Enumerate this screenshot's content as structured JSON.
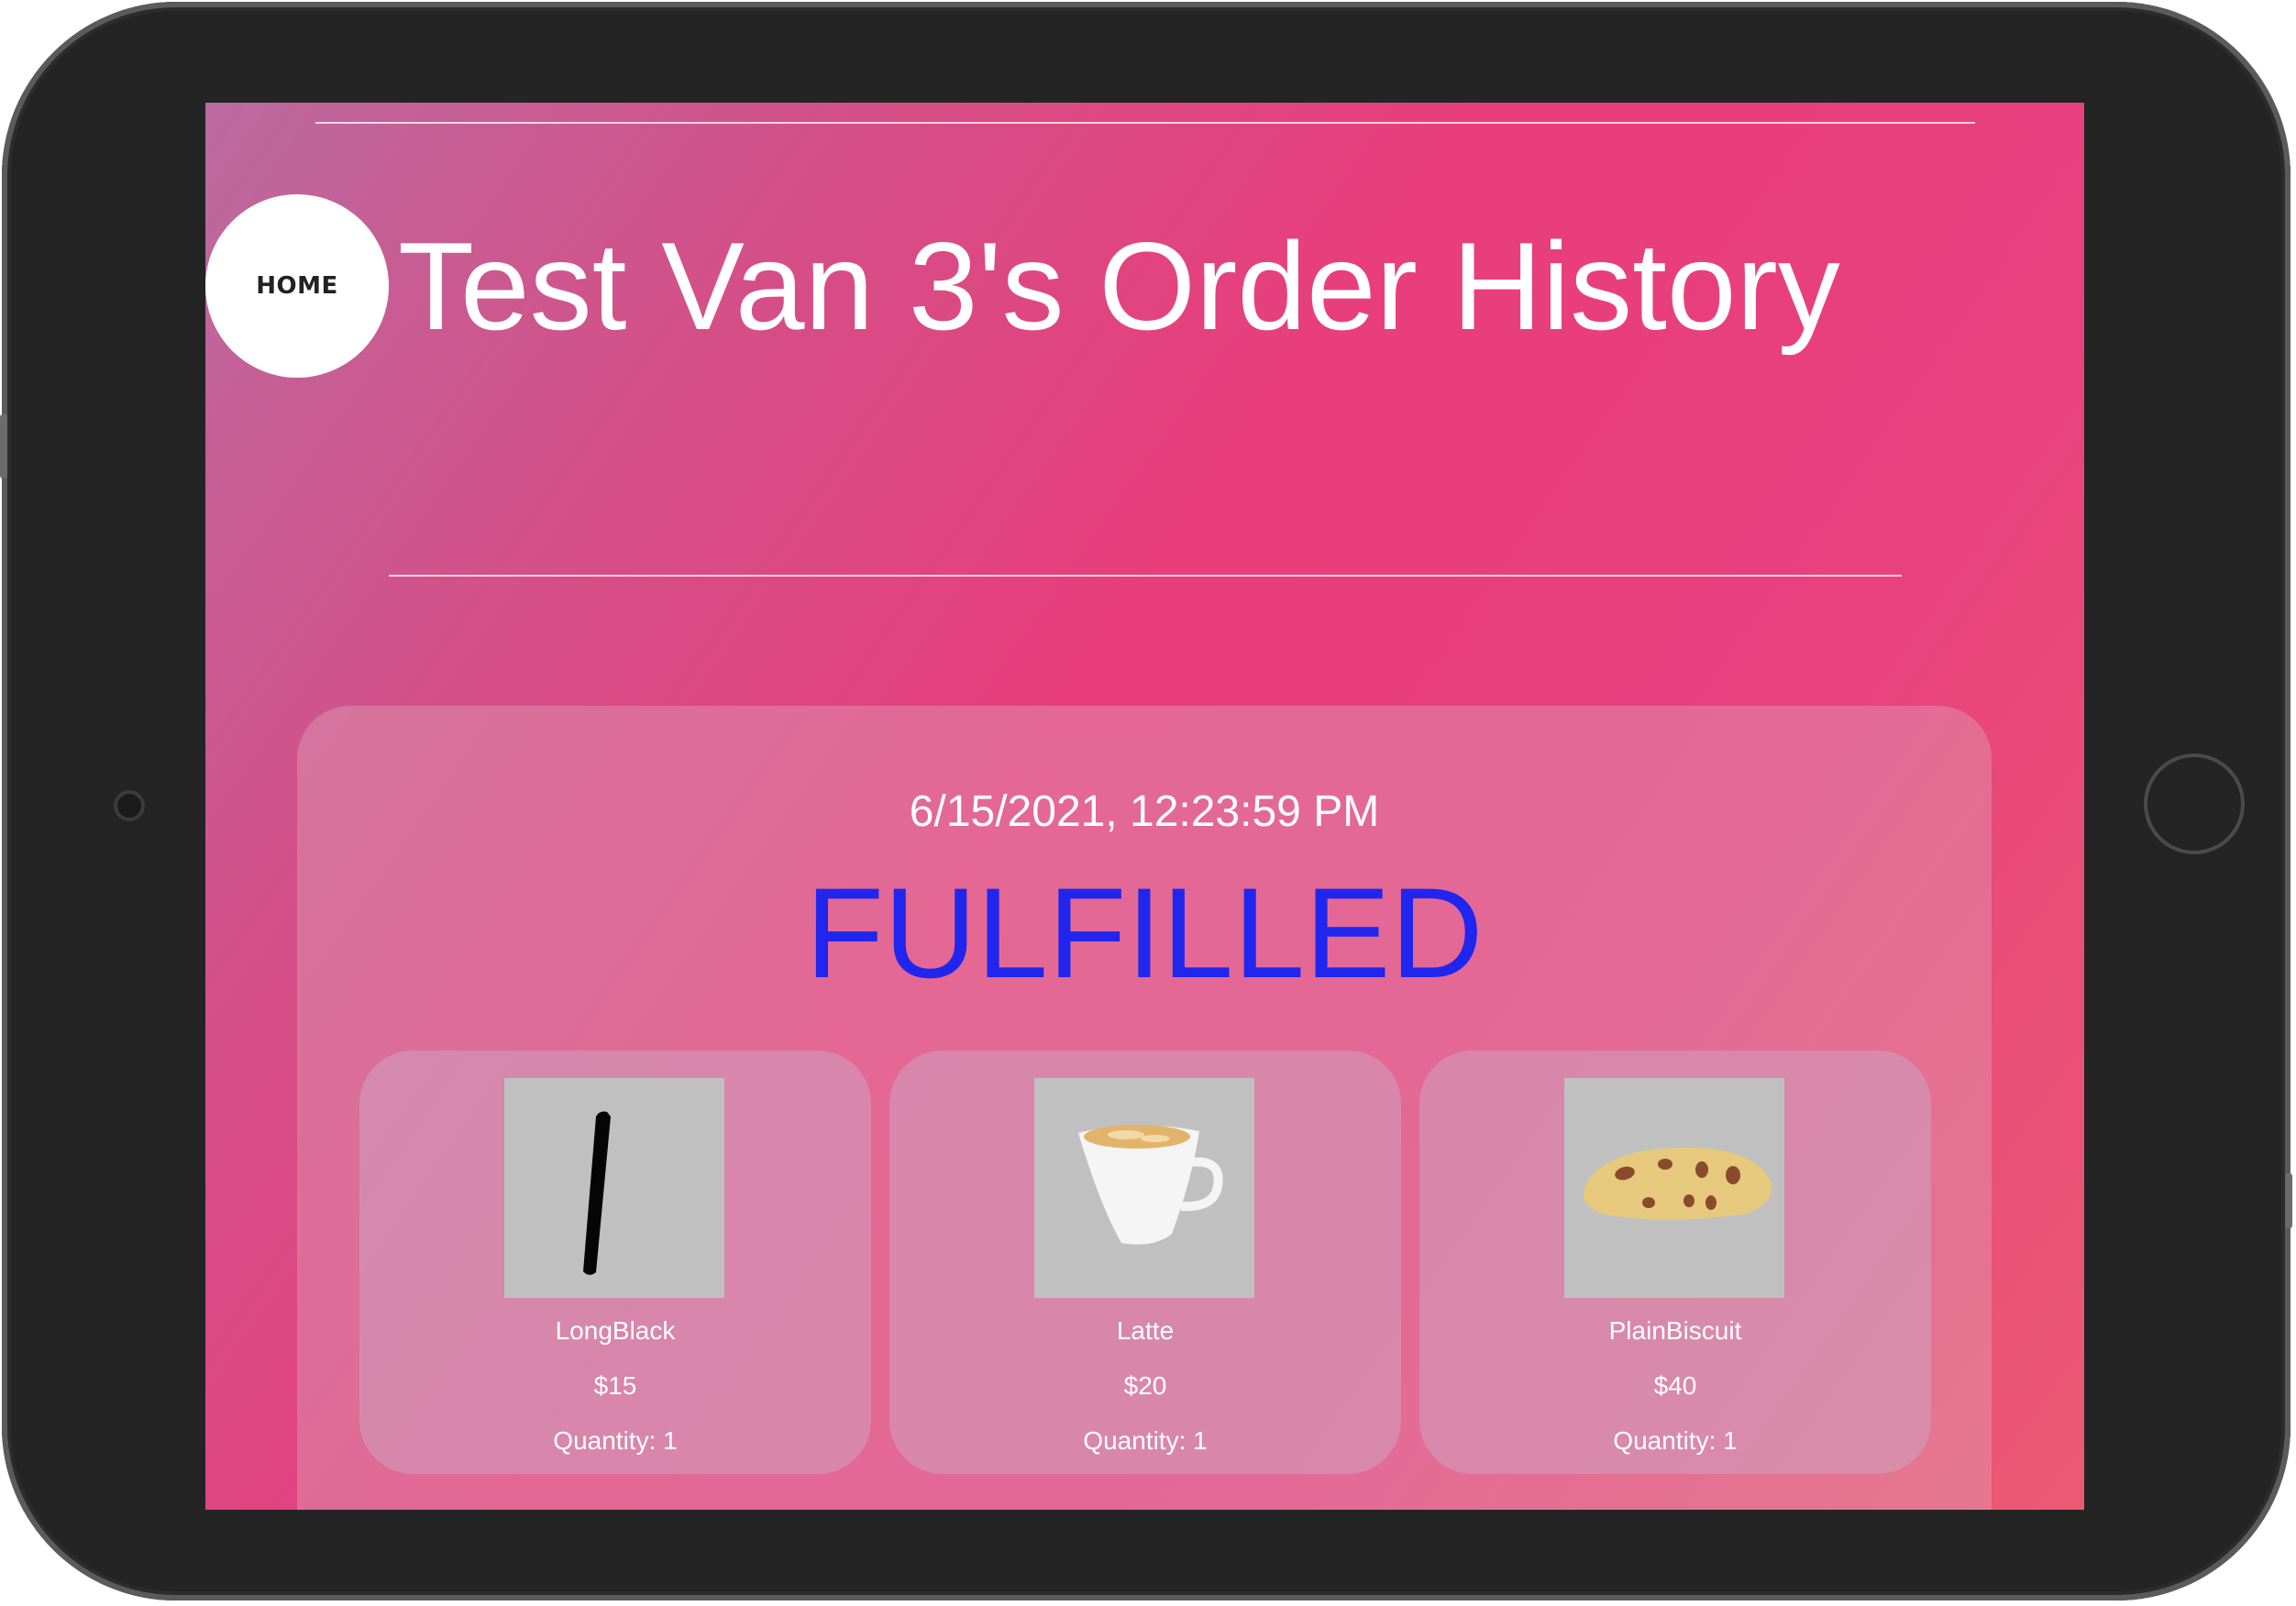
{
  "header": {
    "home_label": "HOME",
    "title": "Test Van 3's Order History"
  },
  "order": {
    "date": "6/15/2021, 12:23:59 PM",
    "status": "FULFILLED",
    "status_color": "#2026ee",
    "items": [
      {
        "name": "LongBlack",
        "price": "$15",
        "quantity": "Quantity: 1",
        "icon": "long-black-icon"
      },
      {
        "name": "Latte",
        "price": "$20",
        "quantity": "Quantity: 1",
        "icon": "latte-cup-icon"
      },
      {
        "name": "PlainBiscuit",
        "price": "$40",
        "quantity": "Quantity: 1",
        "icon": "biscuit-icon"
      }
    ]
  },
  "colors": {
    "device_frame": "#232423",
    "background_gradient": [
      "#bb6aa0",
      "#e83e7b",
      "#ec5a72"
    ]
  }
}
